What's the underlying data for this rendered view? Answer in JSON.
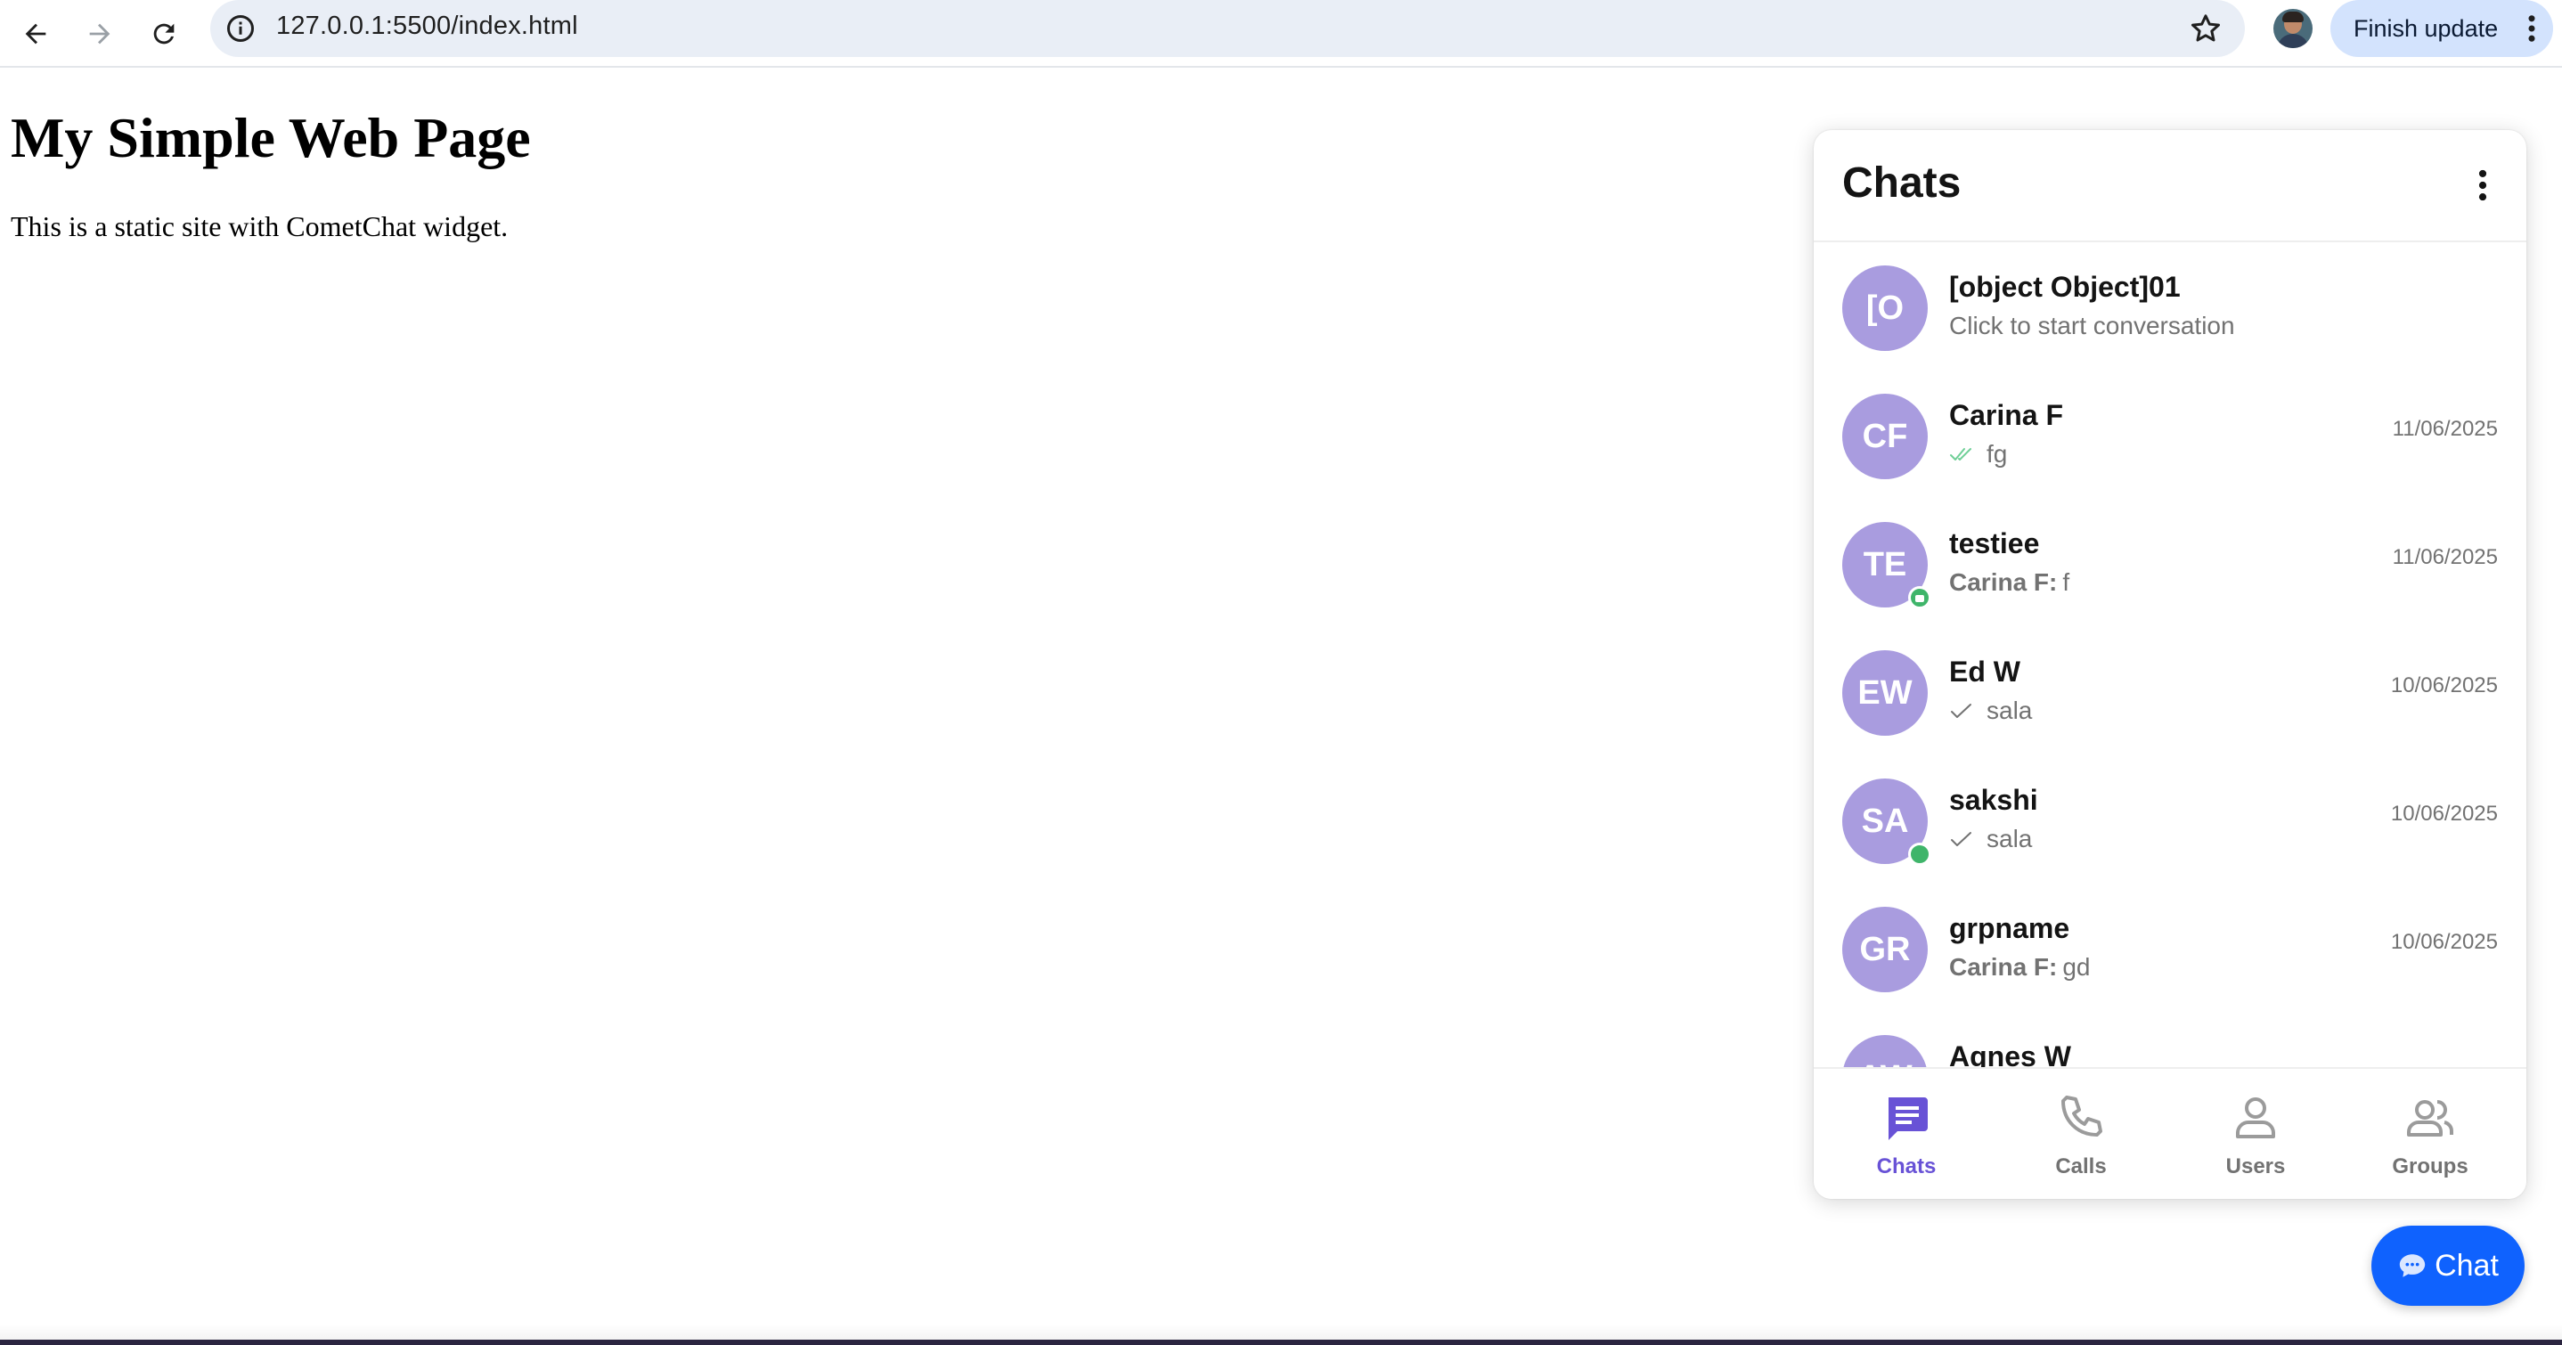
{
  "browser": {
    "url": "127.0.0.1:5500/index.html",
    "finish_update_label": "Finish update"
  },
  "page": {
    "title": "My Simple Web Page",
    "text": "This is a static site with CometChat widget."
  },
  "widget": {
    "title": "Chats",
    "conversations": [
      {
        "initials": "[O",
        "name": "[object Object]01",
        "sender": "",
        "message": "Click to start conversation",
        "date": "",
        "receipt": "none",
        "status": "none"
      },
      {
        "initials": "CF",
        "name": "Carina F",
        "sender": "",
        "message": "fg",
        "date": "11/06/2025",
        "receipt": "read",
        "status": "none"
      },
      {
        "initials": "TE",
        "name": "testiee",
        "sender": "Carina F:",
        "message": "f",
        "date": "11/06/2025",
        "receipt": "none",
        "status": "locked"
      },
      {
        "initials": "EW",
        "name": "Ed W",
        "sender": "",
        "message": "sala",
        "date": "10/06/2025",
        "receipt": "sent",
        "status": "none"
      },
      {
        "initials": "SA",
        "name": "sakshi",
        "sender": "",
        "message": "sala",
        "date": "10/06/2025",
        "receipt": "sent",
        "status": "online"
      },
      {
        "initials": "GR",
        "name": "grpname",
        "sender": "Carina F:",
        "message": "gd",
        "date": "10/06/2025",
        "receipt": "none",
        "status": "none"
      },
      {
        "initials": "AW",
        "name": "Agnes W",
        "sender": "",
        "message": "",
        "date": "",
        "receipt": "none",
        "status": "none"
      }
    ],
    "tabs": [
      {
        "label": "Chats",
        "icon": "chats-icon",
        "active": true
      },
      {
        "label": "Calls",
        "icon": "phone-icon",
        "active": false
      },
      {
        "label": "Users",
        "icon": "user-icon",
        "active": false
      },
      {
        "label": "Groups",
        "icon": "group-icon",
        "active": false
      }
    ],
    "colors": {
      "avatar": "#a99cdf",
      "accent": "#6852d6",
      "online": "#3fb56a",
      "read_receipt": "#6fcf97",
      "launcher": "#0f62fe"
    }
  },
  "launcher": {
    "label": "Chat",
    "icon": "speech-bubble-icon"
  }
}
